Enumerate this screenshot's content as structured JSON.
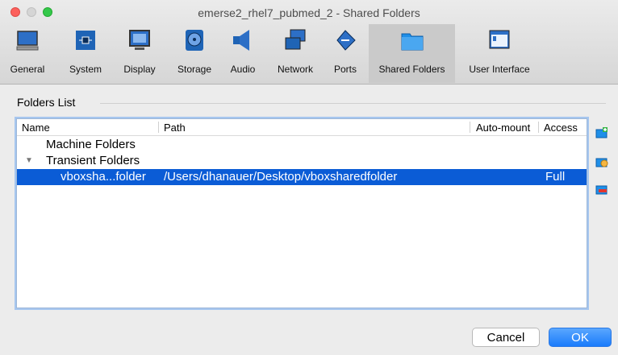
{
  "window": {
    "title": "emerse2_rhel7_pubmed_2 - Shared Folders"
  },
  "toolbar": {
    "items": [
      {
        "label": "General",
        "icon": "monitor-icon"
      },
      {
        "label": "System",
        "icon": "chip-icon"
      },
      {
        "label": "Display",
        "icon": "display-icon"
      },
      {
        "label": "Storage",
        "icon": "disk-icon"
      },
      {
        "label": "Audio",
        "icon": "speaker-icon"
      },
      {
        "label": "Network",
        "icon": "network-icon"
      },
      {
        "label": "Ports",
        "icon": "ports-icon"
      },
      {
        "label": "Shared Folders",
        "icon": "folder-icon",
        "active": true
      },
      {
        "label": "User Interface",
        "icon": "window-icon"
      }
    ]
  },
  "folders_list": {
    "label": "Folders List",
    "columns": [
      "Name",
      "Path",
      "Auto-mount",
      "Access"
    ],
    "rows": [
      {
        "name": "Machine Folders",
        "path": "",
        "automount": "",
        "access": ""
      },
      {
        "name": "Transient Folders",
        "path": "",
        "automount": "",
        "access": ""
      },
      {
        "name": "vboxsha...folder",
        "path": "/Users/dhanauer/Desktop/vboxsharedfolder",
        "automount": "",
        "access": "Full"
      }
    ]
  },
  "buttons": {
    "cancel": "Cancel",
    "ok": "OK"
  },
  "colors": {
    "selection": "#0b5cd6",
    "ok_button": "#1a7bfb",
    "active_tab": "#cacaca"
  }
}
